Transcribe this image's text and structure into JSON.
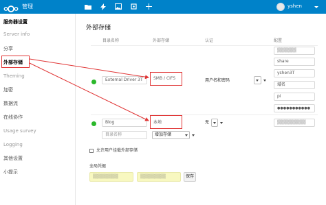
{
  "header": {
    "app_name": "管理",
    "user": "yshen",
    "accent": "#0082c9",
    "icons": [
      "files-icon",
      "activity-icon",
      "gallery-icon",
      "settings-icon",
      "add-icon"
    ]
  },
  "sidebar": {
    "section_title": "服务器设置",
    "items": [
      {
        "label": "Server info",
        "muted": true
      },
      {
        "label": "分享",
        "muted": false
      },
      {
        "label": "外部存储",
        "muted": false,
        "active": true
      },
      {
        "label": "Theming",
        "muted": true
      },
      {
        "label": "加密",
        "muted": false
      },
      {
        "label": "数据流",
        "muted": false
      },
      {
        "label": "在线协作",
        "muted": false
      },
      {
        "label": "Usage survey",
        "muted": true
      },
      {
        "label": "Logging",
        "muted": true
      },
      {
        "label": "其他设置",
        "muted": false
      },
      {
        "label": "小提示",
        "muted": false
      }
    ]
  },
  "main": {
    "title": "外部存储",
    "columns": {
      "folder": "目录名称",
      "storage": "外部存储",
      "auth": "认证",
      "config": "配置"
    },
    "rows": [
      {
        "folder": "External Driver 3T",
        "storage": "SMB / CIFS",
        "auth": "用户名和密码",
        "config": [
          "share",
          "yshen3T",
          "域名",
          "pi",
          "●●●●●●●●●●●"
        ]
      },
      {
        "folder": "Blog",
        "storage": "本地",
        "auth": "无"
      }
    ],
    "new_row": {
      "folder_placeholder": "目录名称",
      "storage_select": "增加存储"
    },
    "allow_users_label": "允许用户挂载外部存储",
    "global_credentials_label": "全局凭据",
    "save_button": "保存"
  },
  "colors": {
    "highlight": "#e03434",
    "status_ok": "#2bb82b"
  }
}
